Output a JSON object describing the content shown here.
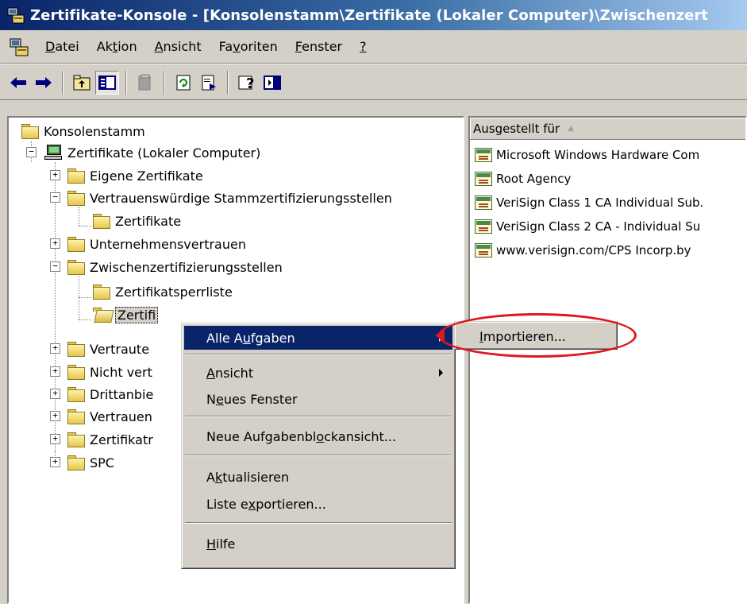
{
  "window": {
    "title": "Zertifikate-Konsole - [Konsolenstamm\\Zertifikate (Lokaler Computer)\\Zwischenzert"
  },
  "menubar": {
    "items": [
      {
        "pre": "",
        "acc": "D",
        "post": "atei"
      },
      {
        "pre": "Ak",
        "acc": "t",
        "post": "ion"
      },
      {
        "pre": "",
        "acc": "A",
        "post": "nsicht"
      },
      {
        "pre": "Fa",
        "acc": "v",
        "post": "oriten"
      },
      {
        "pre": "",
        "acc": "F",
        "post": "enster"
      },
      {
        "pre": "",
        "acc": "?",
        "post": ""
      }
    ]
  },
  "toolbar": {
    "buttons": [
      "back-icon",
      "forward-icon",
      "up-folder-icon",
      "show-hide-tree-icon",
      "delete-icon",
      "refresh-icon",
      "export-list-icon",
      "help-icon",
      "action-pane-icon"
    ],
    "pressed": "show-hide-tree-icon"
  },
  "tree": {
    "root": "Konsolenstamm",
    "computer": "Zertifikate (Lokaler Computer)",
    "items": [
      "Eigene Zertifikate",
      "Vertrauenswürdige Stammzertifizierungsstellen",
      "Zertifikate",
      "Unternehmensvertrauen",
      "Zwischenzertifizierungsstellen",
      "Zertifikatsperrliste",
      "Zertifi",
      "Vertraute",
      "Nicht vert",
      "Drittanbie",
      "Vertrauen",
      "Zertifikatr",
      "SPC"
    ]
  },
  "list": {
    "column_header": "Ausgestellt für",
    "rows": [
      "Microsoft Windows Hardware Com",
      "Root Agency",
      "VeriSign Class 1 CA Individual Sub.",
      "VeriSign Class 2 CA - Individual Su",
      "www.verisign.com/CPS Incorp.by"
    ]
  },
  "context_menu": {
    "all_tasks": {
      "pre": "Alle A",
      "acc": "u",
      "post": "fgaben"
    },
    "view": {
      "pre": "",
      "acc": "A",
      "post": "nsicht"
    },
    "new_window": {
      "pre": "N",
      "acc": "e",
      "post": "ues Fenster"
    },
    "new_taskpad": {
      "pre": "Neue Aufgabenbl",
      "acc": "o",
      "post": "ckansicht..."
    },
    "refresh": {
      "pre": "A",
      "acc": "k",
      "post": "tualisieren"
    },
    "export_list": {
      "pre": "Liste e",
      "acc": "x",
      "post": "portieren..."
    },
    "help": {
      "pre": "",
      "acc": "H",
      "post": "ilfe"
    }
  },
  "submenu": {
    "import": {
      "pre": "",
      "acc": "I",
      "post": "mportieren..."
    }
  },
  "colors": {
    "highlight": "#0a246a",
    "annotation": "#e0171b",
    "face": "#d4d0c8"
  }
}
